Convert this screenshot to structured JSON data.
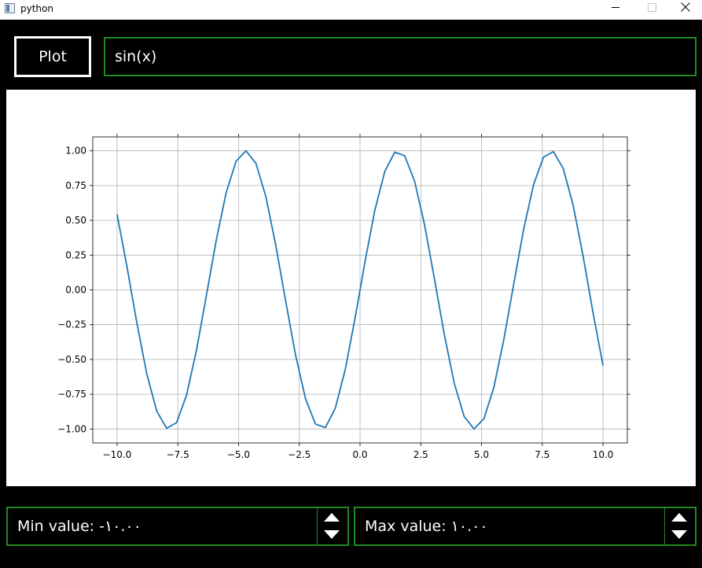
{
  "window": {
    "title": "python"
  },
  "toolbar": {
    "plot_label": "Plot",
    "expression_value": "sin(x)"
  },
  "controls": {
    "min_label": "Min value: ",
    "min_value": "-١٠.٠٠",
    "max_label": "Max value: ",
    "max_value": "١٠.٠٠"
  },
  "colors": {
    "accent_border": "#1f8a1f",
    "line": "#1f77b4"
  },
  "chart_data": {
    "type": "line",
    "function": "sin(x)",
    "x_range": [
      -10,
      10
    ],
    "samples": 50,
    "xlim": [
      -11,
      11
    ],
    "ylim": [
      -1.1,
      1.1
    ],
    "x_ticks": [
      "−10.0",
      "−7.5",
      "−5.0",
      "−2.5",
      "0.0",
      "2.5",
      "5.0",
      "7.5",
      "10.0"
    ],
    "y_ticks": [
      "−1.00",
      "−0.75",
      "−0.50",
      "−0.25",
      "0.00",
      "0.25",
      "0.50",
      "0.75",
      "1.00"
    ],
    "grid": true,
    "xlabel": "",
    "ylabel": "",
    "title": ""
  }
}
